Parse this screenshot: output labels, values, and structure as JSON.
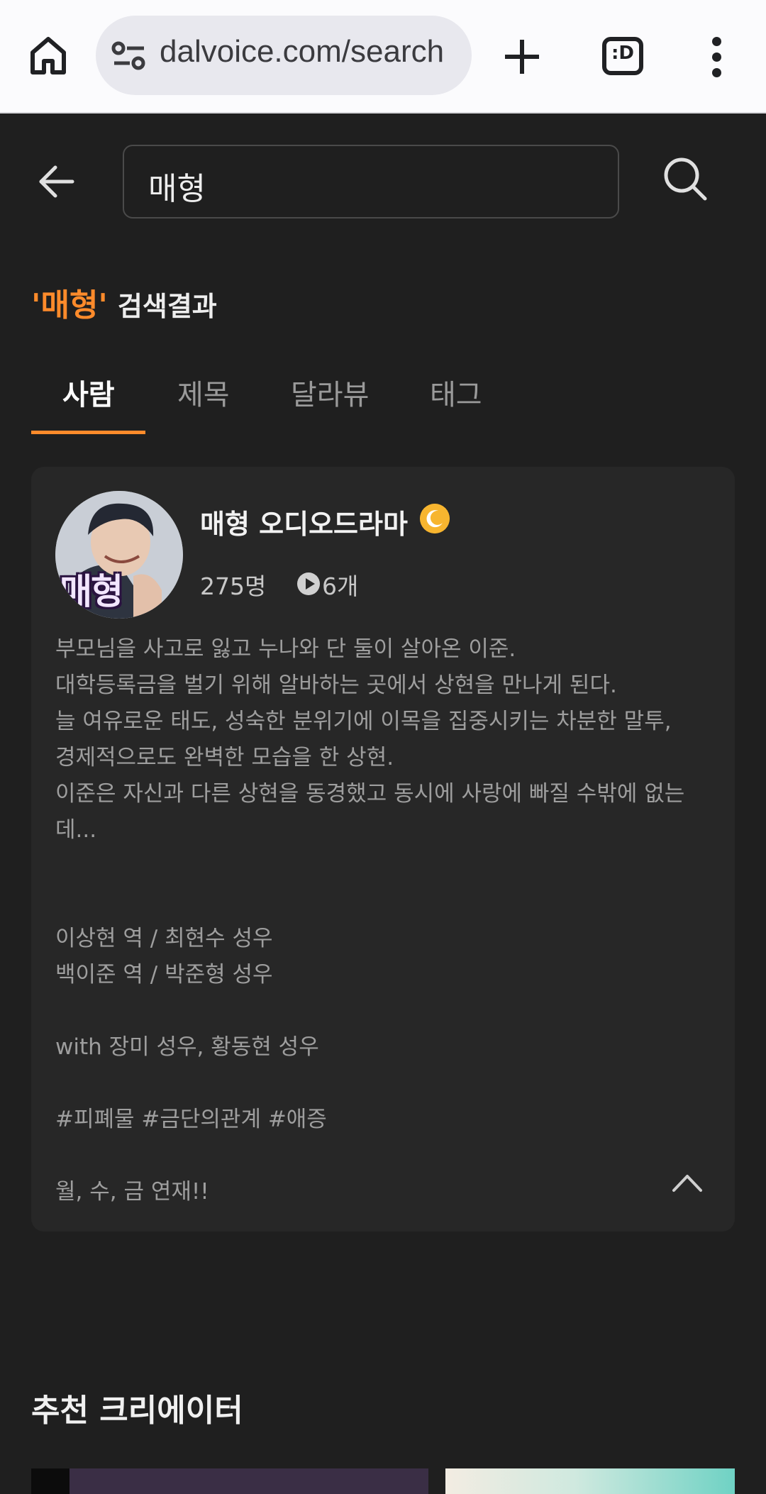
{
  "browser": {
    "url": "dalvoice.com/search",
    "tab_count": ":D",
    "icons": [
      "home-icon",
      "tune-icon",
      "plus-icon",
      "tabs-icon",
      "more-vert-icon"
    ]
  },
  "search": {
    "query": "매형",
    "result_query": "'매형'",
    "result_label": "검색결과"
  },
  "tabs": [
    {
      "label": "사람",
      "active": true
    },
    {
      "label": "제목",
      "active": false
    },
    {
      "label": "달라뷰",
      "active": false
    },
    {
      "label": "태그",
      "active": false
    }
  ],
  "creator": {
    "avatar_text": "매형",
    "name": "매형 오디오드라마",
    "fans": "275명",
    "casts": "6개",
    "description_lines": [
      "부모님을 사고로 잃고 누나와 단 둘이 살아온 이준.",
      "대학등록금을 벌기 위해 알바하는 곳에서 상현을 만나게 된다.",
      "늘 여유로운 태도, 성숙한 분위기에 이목을 집중시키는 차분한 말투,",
      "경제적으로도 완벽한 모습을 한 상현.",
      "이준은 자신과 다른 상현을 동경했고 동시에 사랑에 빠질 수밖에 없는",
      "데...",
      "",
      "",
      "이상현 역 / 최현수 성우",
      "백이준 역 / 박준형 성우",
      "",
      "with 장미 성우, 황동현 성우",
      "",
      "#피폐물 #금단의관계 #애증",
      "",
      "월, 수, 금 연재!!"
    ]
  },
  "recommend": {
    "title": "추천 크리에이터"
  },
  "colors": {
    "accent": "#ff8b2b",
    "background": "#1f1f1f",
    "card": "#272727",
    "badge": "#f7b52f"
  }
}
